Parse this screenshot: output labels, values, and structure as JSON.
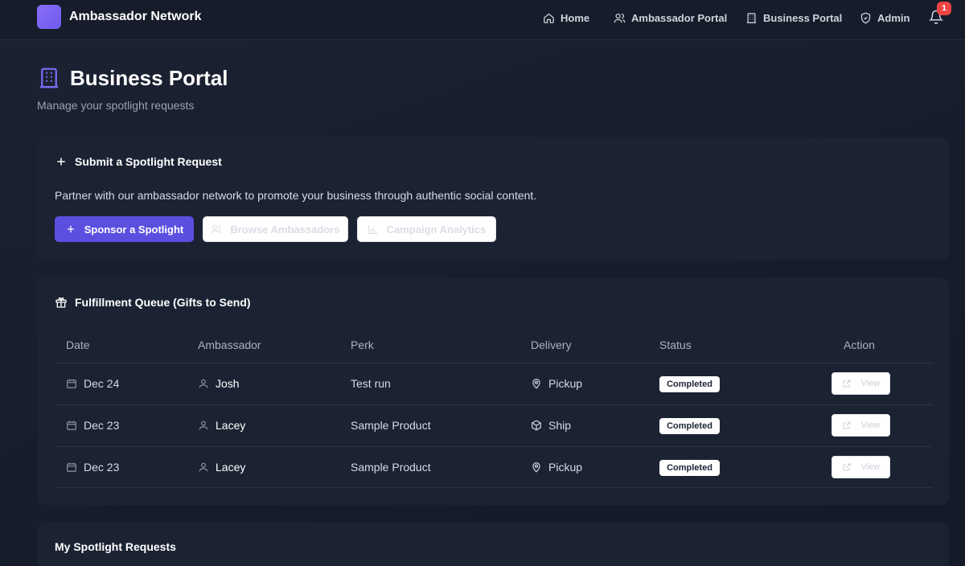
{
  "nav": {
    "brand": "Ambassador Network",
    "links": [
      {
        "label": "Home",
        "icon": "home-icon"
      },
      {
        "label": "Ambassador Portal",
        "icon": "users-icon"
      },
      {
        "label": "Business Portal",
        "icon": "building-icon"
      },
      {
        "label": "Admin",
        "icon": "shield-icon"
      }
    ],
    "notification_count": "1"
  },
  "header": {
    "title": "Business Portal",
    "subtitle": "Manage your spotlight requests"
  },
  "submit_card": {
    "title": "Submit a Spotlight Request",
    "description": "Partner with our ambassador network to promote your business through authentic social content.",
    "buttons": {
      "sponsor": "Sponsor a Spotlight",
      "browse": "Browse Ambassadors",
      "analytics": "Campaign Analytics"
    }
  },
  "fulfillment": {
    "title": "Fulfillment Queue (Gifts to Send)",
    "columns": [
      "Date",
      "Ambassador",
      "Perk",
      "Delivery",
      "Status",
      "Action"
    ],
    "rows": [
      {
        "date": "Dec 24",
        "ambassador": "Josh",
        "perk": "Test run",
        "delivery": "Pickup",
        "delivery_icon": "map-pin-icon",
        "status": "Completed",
        "action": "View"
      },
      {
        "date": "Dec 23",
        "ambassador": "Lacey",
        "perk": "Sample Product",
        "delivery": "Ship",
        "delivery_icon": "package-icon",
        "status": "Completed",
        "action": "View"
      },
      {
        "date": "Dec 23",
        "ambassador": "Lacey",
        "perk": "Sample Product",
        "delivery": "Pickup",
        "delivery_icon": "map-pin-icon",
        "status": "Completed",
        "action": "View"
      }
    ]
  },
  "my_requests": {
    "title": "My Spotlight Requests"
  },
  "colors": {
    "accent": "#5b4fe0",
    "badge_red": "#ef4444",
    "background": "#161c29"
  }
}
